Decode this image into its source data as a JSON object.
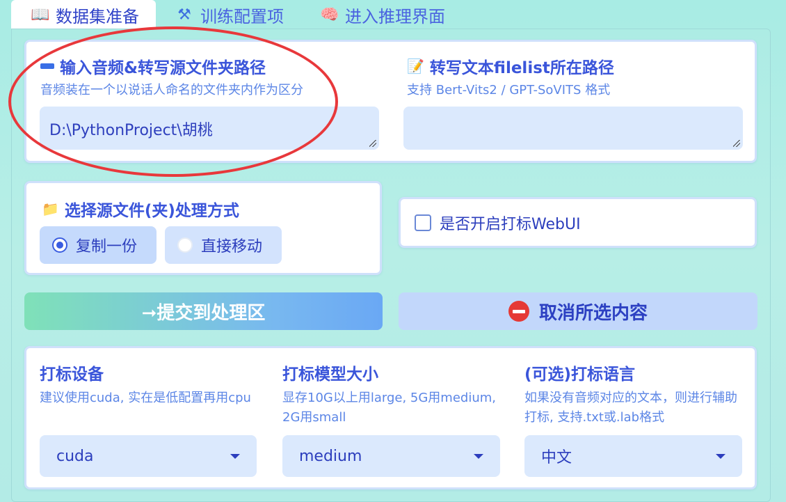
{
  "tabs": [
    {
      "icon": "📖",
      "label": "数据集准备"
    },
    {
      "icon": "⚒",
      "label": "训练配置项"
    },
    {
      "icon": "🧠",
      "label": "进入推理界面"
    }
  ],
  "input_section": {
    "source": {
      "label": "输入音频&转写源文件夹路径",
      "hint": "音频装在一个以说话人命名的文件夹内作为区分",
      "value": "D:\\PythonProject\\胡桃"
    },
    "filelist": {
      "label": "转写文本filelist所在路径",
      "hint": "支持 Bert-Vits2 / GPT-SoVITS 格式",
      "value": ""
    }
  },
  "process_mode": {
    "label": "选择源文件(夹)处理方式",
    "options": [
      "复制一份",
      "直接移动"
    ],
    "selected": "复制一份"
  },
  "webui_checkbox": {
    "label": "是否开启打标WebUI",
    "checked": false
  },
  "buttons": {
    "submit": "➞提交到处理区",
    "cancel": "取消所选内容"
  },
  "settings": {
    "device": {
      "title": "打标设备",
      "hint": "建议使用cuda, 实在是低配置再用cpu",
      "value": "cuda"
    },
    "model_size": {
      "title": "打标模型大小",
      "hint": "显存10G以上用large, 5G用medium, 2G用small",
      "value": "medium"
    },
    "language": {
      "title": "(可选)打标语言",
      "hint": "如果没有音频对应的文本，则进行辅助打标, 支持.txt或.lab格式",
      "value": "中文"
    }
  },
  "colors": {
    "accent": "#3a55da",
    "annotation_ellipse": "#e8383b",
    "cancel_icon": "#e53935"
  }
}
